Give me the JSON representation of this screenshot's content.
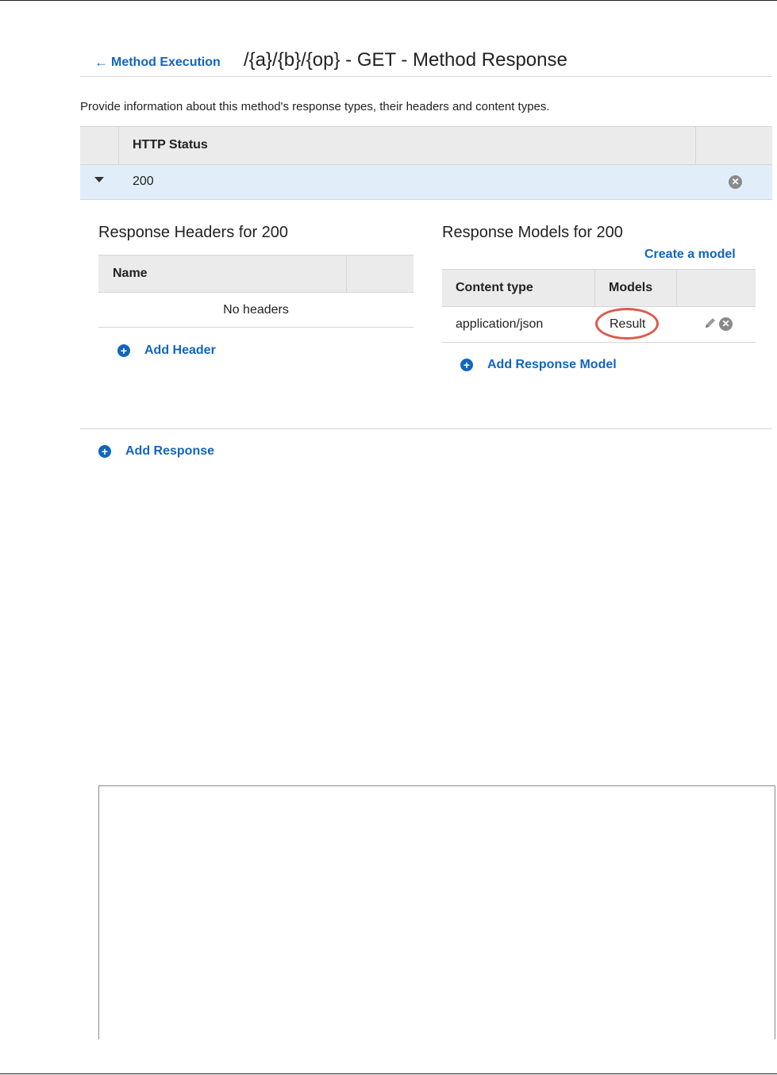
{
  "header": {
    "back_label": "Method Execution",
    "title": "/{a}/{b}/{op} - GET - Method Response"
  },
  "description": "Provide information about this method's response types, their headers and content types.",
  "status_table": {
    "column_header": "HTTP Status",
    "rows": [
      {
        "code": "200",
        "expanded": true
      }
    ]
  },
  "response_headers": {
    "title": "Response Headers for 200",
    "column_name": "Name",
    "empty_text": "No headers",
    "add_label": "Add Header"
  },
  "response_models": {
    "title": "Response Models for 200",
    "create_label": "Create a model",
    "columns": [
      "Content type",
      "Models"
    ],
    "rows": [
      {
        "content_type": "application/json",
        "model": "Result",
        "highlighted": true
      }
    ],
    "add_label": "Add Response Model"
  },
  "add_response_label": "Add Response",
  "colors": {
    "link": "#1166bb",
    "selected_row": "#e1eef9",
    "highlight_circle": "#e0584a"
  },
  "icons": {
    "back": "arrow-left-icon",
    "expand": "caret-down-icon",
    "remove": "remove-circle-icon",
    "add": "plus-circle-icon",
    "edit": "pencil-icon"
  }
}
